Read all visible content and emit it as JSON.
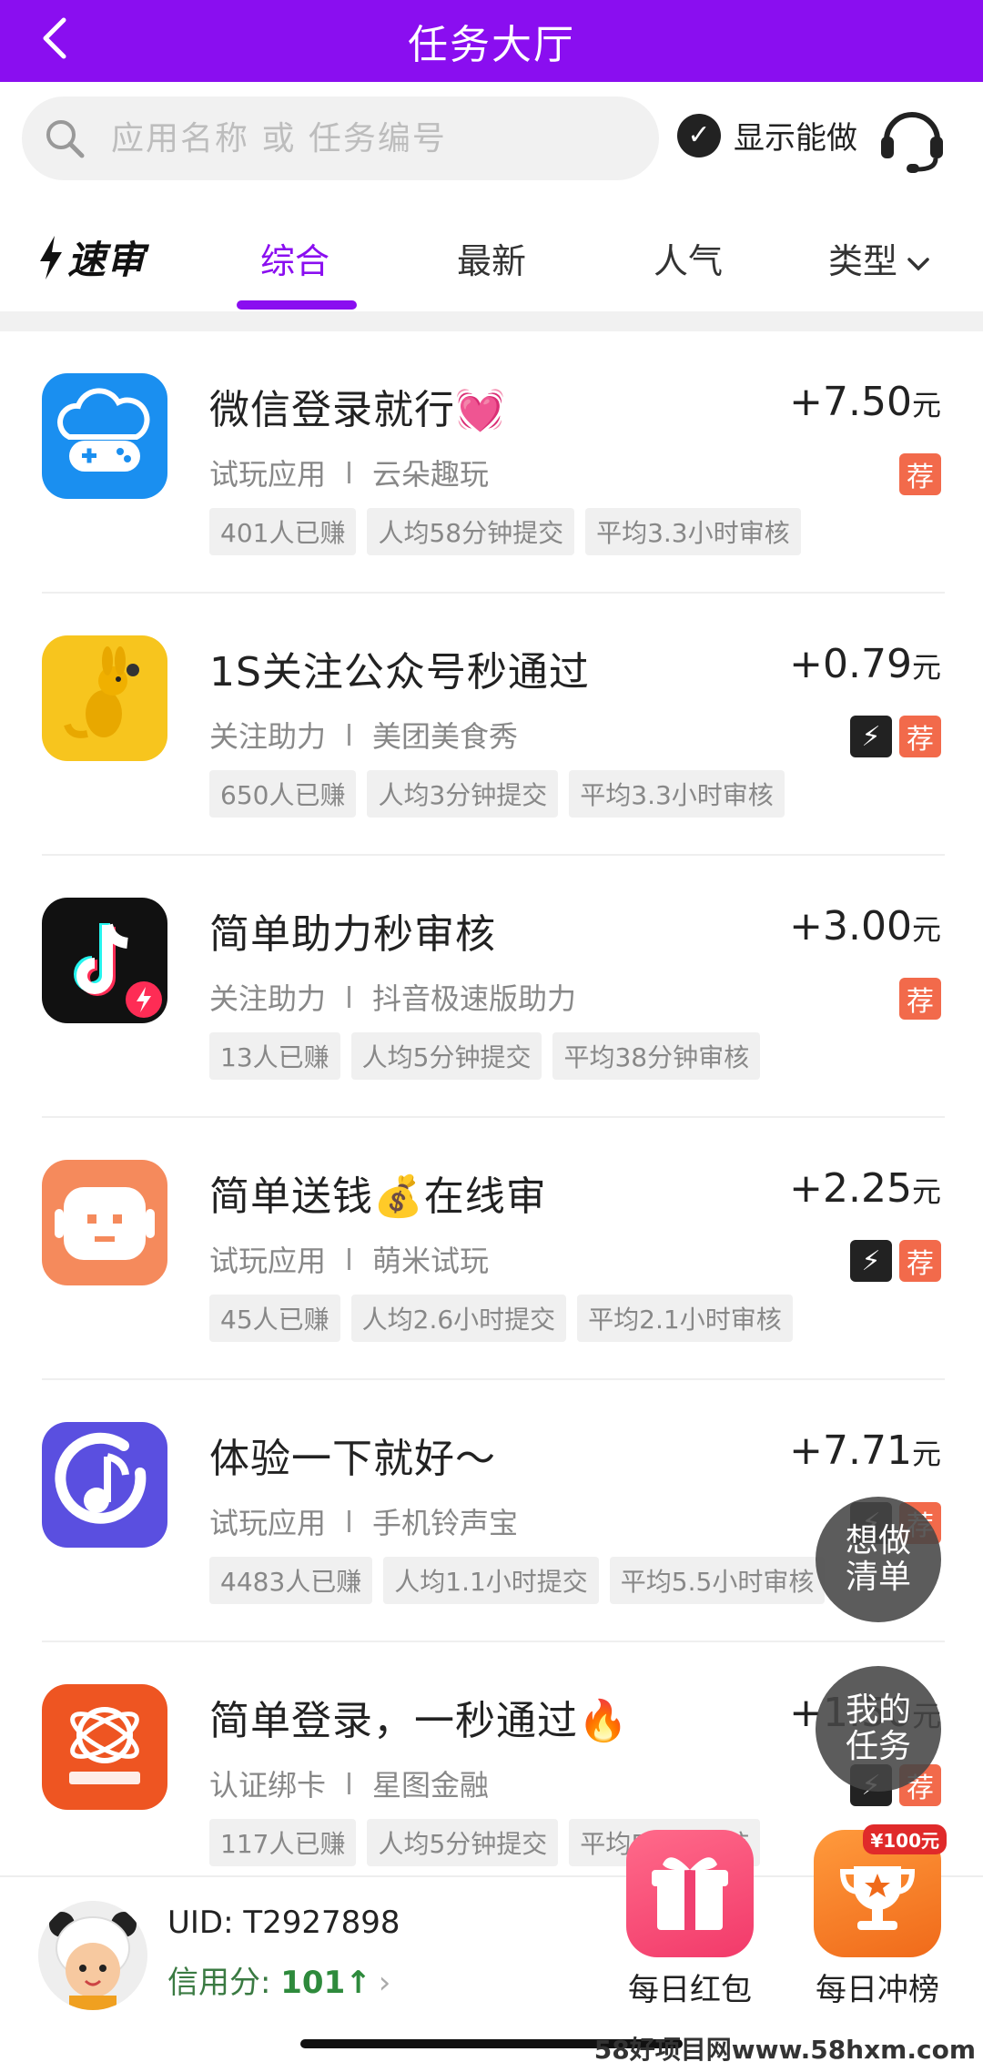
{
  "header": {
    "title": "任务大厅"
  },
  "search": {
    "placeholder": "应用名称 或 任务编号",
    "show_can_do": "显示能做"
  },
  "tabs": {
    "speed_label": "速审",
    "items": [
      "综合",
      "最新",
      "人气",
      "类型"
    ],
    "active": "综合"
  },
  "tasks": [
    {
      "title": "微信登录就行💓",
      "category": "试玩应用",
      "app": "云朵趣玩",
      "tags": [
        "401人已赚",
        "人均58分钟提交",
        "平均3.3小时审核"
      ],
      "price": "+7.50",
      "unit": "元",
      "fast": false,
      "recommend": true,
      "icon": "cloud-gamepad-icon",
      "color": "#1a8ff0"
    },
    {
      "title": "1S关注公众号秒通过",
      "category": "关注助力",
      "app": "美团美食秀",
      "tags": [
        "650人已赚",
        "人均3分钟提交",
        "平均3.3小时审核"
      ],
      "price": "+0.79",
      "unit": "元",
      "fast": true,
      "recommend": true,
      "icon": "kangaroo-icon",
      "color": "#f7c51e"
    },
    {
      "title": "简单助力秒审核",
      "category": "关注助力",
      "app": "抖音极速版助力",
      "tags": [
        "13人已赚",
        "人均5分钟提交",
        "平均38分钟审核"
      ],
      "price": "+3.00",
      "unit": "元",
      "fast": false,
      "recommend": true,
      "icon": "tiktok-lite-icon",
      "color": "#111111"
    },
    {
      "title": "简单送钱💰在线审",
      "category": "试玩应用",
      "app": "萌米试玩",
      "tags": [
        "45人已赚",
        "人均2.6小时提交",
        "平均2.1小时审核"
      ],
      "price": "+2.25",
      "unit": "元",
      "fast": true,
      "recommend": true,
      "icon": "robot-face-icon",
      "color": "#f58a5c"
    },
    {
      "title": "体验一下就好～",
      "category": "试玩应用",
      "app": "手机铃声宝",
      "tags": [
        "4483人已赚",
        "人均1.1小时提交",
        "平均5.5小时审核"
      ],
      "price": "+7.71",
      "unit": "元",
      "fast": true,
      "recommend": true,
      "icon": "music-note-icon",
      "color": "#5a4fe0"
    },
    {
      "title": "简单登录，一秒通过🔥",
      "category": "认证绑卡",
      "app": "星图金融",
      "tags": [
        "117人已赚",
        "人均5分钟提交",
        "平均5分钟审核"
      ],
      "price": "+1.50",
      "unit": "元",
      "fast": true,
      "recommend": true,
      "icon": "star-atlas-icon",
      "color": "#ee5522"
    }
  ],
  "floating": {
    "wish": [
      "想做",
      "清单"
    ],
    "mine": [
      "我的",
      "任务"
    ]
  },
  "bottom": {
    "uid": "UID: T2927898",
    "credit_label": "信用分: ",
    "credit_value": "101",
    "daily_red_packet": "每日红包",
    "daily_rank": "每日冲榜",
    "rank_badge": "¥100元"
  },
  "watermark": "58好项目网www.58hxm.com"
}
